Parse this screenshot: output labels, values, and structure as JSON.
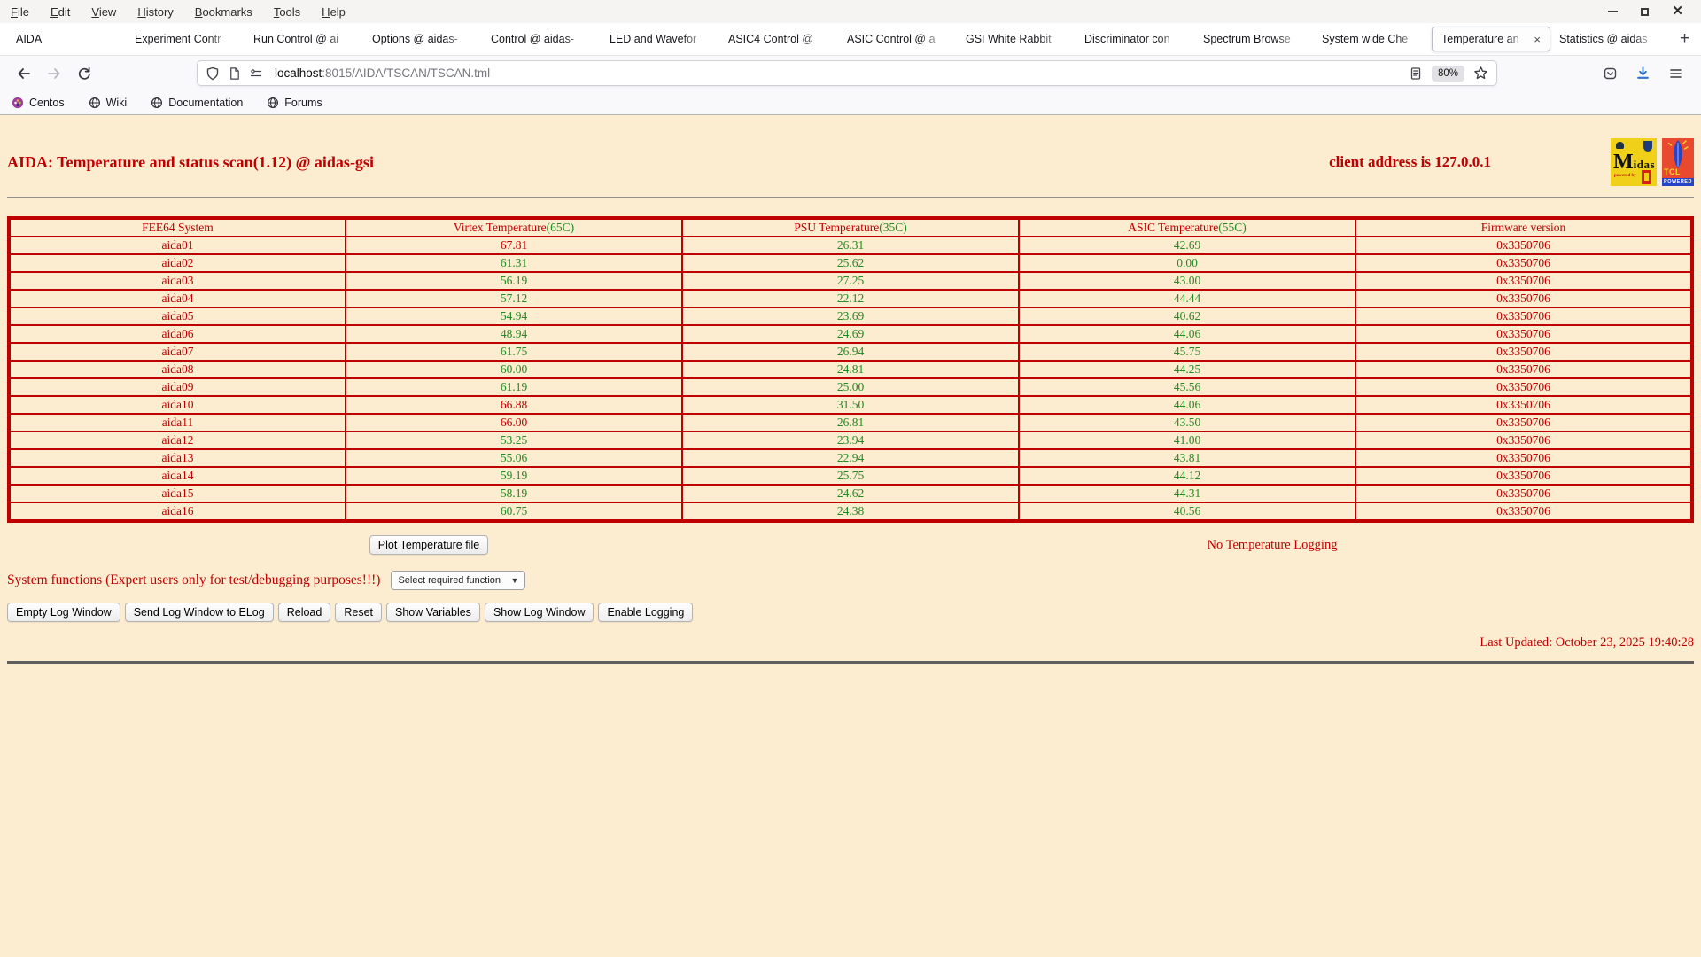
{
  "colors": {
    "accent_red": "#c00000",
    "ok_green": "#228b22",
    "page_bg": "#fcecd0",
    "table_border": "#c00000",
    "download_blue": "#2f6fd0"
  },
  "browser": {
    "menu": [
      "File",
      "Edit",
      "View",
      "History",
      "Bookmarks",
      "Tools",
      "Help"
    ],
    "tabs": [
      {
        "label": "AIDA",
        "active": false
      },
      {
        "label": "Experiment Contr",
        "active": false
      },
      {
        "label": "Run Control @ ai",
        "active": false
      },
      {
        "label": "Options @ aidas-",
        "active": false
      },
      {
        "label": "Control @ aidas-",
        "active": false
      },
      {
        "label": "LED and Wavefor",
        "active": false
      },
      {
        "label": "ASIC4 Control @",
        "active": false
      },
      {
        "label": "ASIC Control @ a",
        "active": false
      },
      {
        "label": "GSI White Rabbit",
        "active": false
      },
      {
        "label": "Discriminator con",
        "active": false
      },
      {
        "label": "Spectrum Browse",
        "active": false
      },
      {
        "label": "System wide Che",
        "active": false
      },
      {
        "label": "Temperature an",
        "active": true
      },
      {
        "label": "Statistics @ aidas",
        "active": false
      }
    ],
    "new_tab_label": "+",
    "urlbar": {
      "host": "localhost",
      "rest": ":8015/AIDA/TSCAN/TSCAN.tml",
      "zoom_badge": "80%"
    },
    "bookmarks": [
      {
        "label": "Centos",
        "icon": "centos-icon"
      },
      {
        "label": "Wiki",
        "icon": "globe-icon"
      },
      {
        "label": "Documentation",
        "icon": "globe-icon"
      },
      {
        "label": "Forums",
        "icon": "globe-icon"
      }
    ]
  },
  "page": {
    "title": "AIDA: Temperature and status scan(1.12) @ aidas-gsi",
    "client_address": "client address is 127.0.0.1",
    "logos": {
      "midas_big": "M",
      "midas_rest": "idas",
      "midas_powered": "powered by",
      "tcl_text": "TCL",
      "tcl_powered": "POWERED"
    },
    "table": {
      "headers": [
        {
          "label": "FEE64 System",
          "threshold": ""
        },
        {
          "label": "Virtex Temperature",
          "threshold": "(65C)"
        },
        {
          "label": "PSU Temperature",
          "threshold": "(35C)"
        },
        {
          "label": "ASIC Temperature",
          "threshold": "(55C)"
        },
        {
          "label": "Firmware version",
          "threshold": ""
        }
      ],
      "rows": [
        {
          "system": "aida01",
          "virtex": "67.81",
          "virtex_status": "alarm",
          "psu": "26.31",
          "psu_status": "ok",
          "asic": "42.69",
          "asic_status": "ok",
          "firmware": "0x3350706"
        },
        {
          "system": "aida02",
          "virtex": "61.31",
          "virtex_status": "ok",
          "psu": "25.62",
          "psu_status": "ok",
          "asic": "0.00",
          "asic_status": "ok",
          "firmware": "0x3350706"
        },
        {
          "system": "aida03",
          "virtex": "56.19",
          "virtex_status": "ok",
          "psu": "27.25",
          "psu_status": "ok",
          "asic": "43.00",
          "asic_status": "ok",
          "firmware": "0x3350706"
        },
        {
          "system": "aida04",
          "virtex": "57.12",
          "virtex_status": "ok",
          "psu": "22.12",
          "psu_status": "ok",
          "asic": "44.44",
          "asic_status": "ok",
          "firmware": "0x3350706"
        },
        {
          "system": "aida05",
          "virtex": "54.94",
          "virtex_status": "ok",
          "psu": "23.69",
          "psu_status": "ok",
          "asic": "40.62",
          "asic_status": "ok",
          "firmware": "0x3350706"
        },
        {
          "system": "aida06",
          "virtex": "48.94",
          "virtex_status": "ok",
          "psu": "24.69",
          "psu_status": "ok",
          "asic": "44.06",
          "asic_status": "ok",
          "firmware": "0x3350706"
        },
        {
          "system": "aida07",
          "virtex": "61.75",
          "virtex_status": "ok",
          "psu": "26.94",
          "psu_status": "ok",
          "asic": "45.75",
          "asic_status": "ok",
          "firmware": "0x3350706"
        },
        {
          "system": "aida08",
          "virtex": "60.00",
          "virtex_status": "ok",
          "psu": "24.81",
          "psu_status": "ok",
          "asic": "44.25",
          "asic_status": "ok",
          "firmware": "0x3350706"
        },
        {
          "system": "aida09",
          "virtex": "61.19",
          "virtex_status": "ok",
          "psu": "25.00",
          "psu_status": "ok",
          "asic": "45.56",
          "asic_status": "ok",
          "firmware": "0x3350706"
        },
        {
          "system": "aida10",
          "virtex": "66.88",
          "virtex_status": "alarm",
          "psu": "31.50",
          "psu_status": "ok",
          "asic": "44.06",
          "asic_status": "ok",
          "firmware": "0x3350706"
        },
        {
          "system": "aida11",
          "virtex": "66.00",
          "virtex_status": "alarm",
          "psu": "26.81",
          "psu_status": "ok",
          "asic": "43.50",
          "asic_status": "ok",
          "firmware": "0x3350706"
        },
        {
          "system": "aida12",
          "virtex": "53.25",
          "virtex_status": "ok",
          "psu": "23.94",
          "psu_status": "ok",
          "asic": "41.00",
          "asic_status": "ok",
          "firmware": "0x3350706"
        },
        {
          "system": "aida13",
          "virtex": "55.06",
          "virtex_status": "ok",
          "psu": "22.94",
          "psu_status": "ok",
          "asic": "43.81",
          "asic_status": "ok",
          "firmware": "0x3350706"
        },
        {
          "system": "aida14",
          "virtex": "59.19",
          "virtex_status": "ok",
          "psu": "25.75",
          "psu_status": "ok",
          "asic": "44.12",
          "asic_status": "ok",
          "firmware": "0x3350706"
        },
        {
          "system": "aida15",
          "virtex": "58.19",
          "virtex_status": "ok",
          "psu": "24.62",
          "psu_status": "ok",
          "asic": "44.31",
          "asic_status": "ok",
          "firmware": "0x3350706"
        },
        {
          "system": "aida16",
          "virtex": "60.75",
          "virtex_status": "ok",
          "psu": "24.38",
          "psu_status": "ok",
          "asic": "40.56",
          "asic_status": "ok",
          "firmware": "0x3350706"
        }
      ]
    },
    "plot_button": "Plot Temperature file",
    "logging_status": "No Temperature Logging",
    "system_functions_label": "System functions (Expert users only for test/debugging purposes!!!)",
    "function_select": "Select required function",
    "system_buttons": [
      "Empty Log Window",
      "Send Log Window to ELog",
      "Reload",
      "Reset",
      "Show Variables",
      "Show Log Window",
      "Enable Logging"
    ],
    "last_updated": "Last Updated: October 23, 2025 19:40:28"
  }
}
